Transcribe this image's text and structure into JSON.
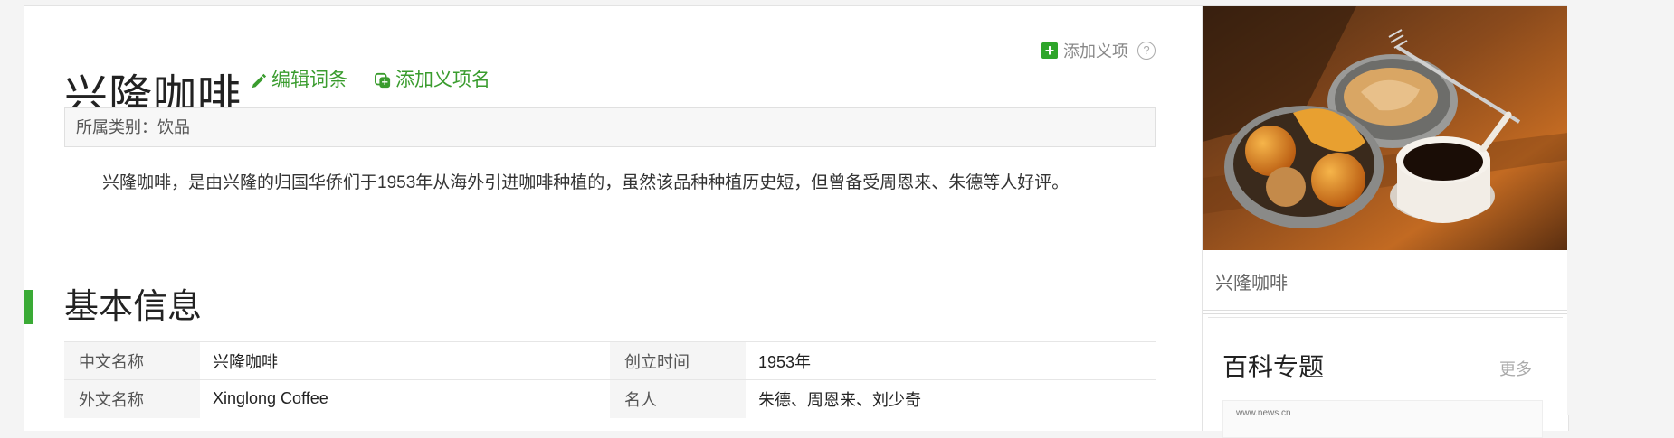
{
  "entry": {
    "title": "兴隆咖啡",
    "edit_label": "编辑词条",
    "add_name_label": "添加义项名",
    "add_sense_label": "添加义项",
    "help_glyph": "?",
    "category_label": "所属类别：饮品",
    "summary": "兴隆咖啡，是由兴隆的归国华侨们于1953年从海外引进咖啡种植的，虽然该品种种植历史短，但曾备受周恩来、朱德等人好评。"
  },
  "basic_info": {
    "heading": "基本信息",
    "rows": [
      [
        {
          "key": "中文名称",
          "value": "兴隆咖啡"
        },
        {
          "key": "创立时间",
          "value": "1953年"
        }
      ],
      [
        {
          "key": "外文名称",
          "value": "Xinglong Coffee"
        },
        {
          "key": "名人",
          "value": "朱德、周恩来、刘少奇"
        }
      ]
    ]
  },
  "sidebar": {
    "image_caption": "兴隆咖啡",
    "topic_heading": "百科专题",
    "topic_more": "更多",
    "thumb_text": "www.news.cn"
  },
  "colors": {
    "accent_green": "#3a9c2e",
    "section_bar": "#3aaa35",
    "plus_icon": "#2ea52a"
  }
}
